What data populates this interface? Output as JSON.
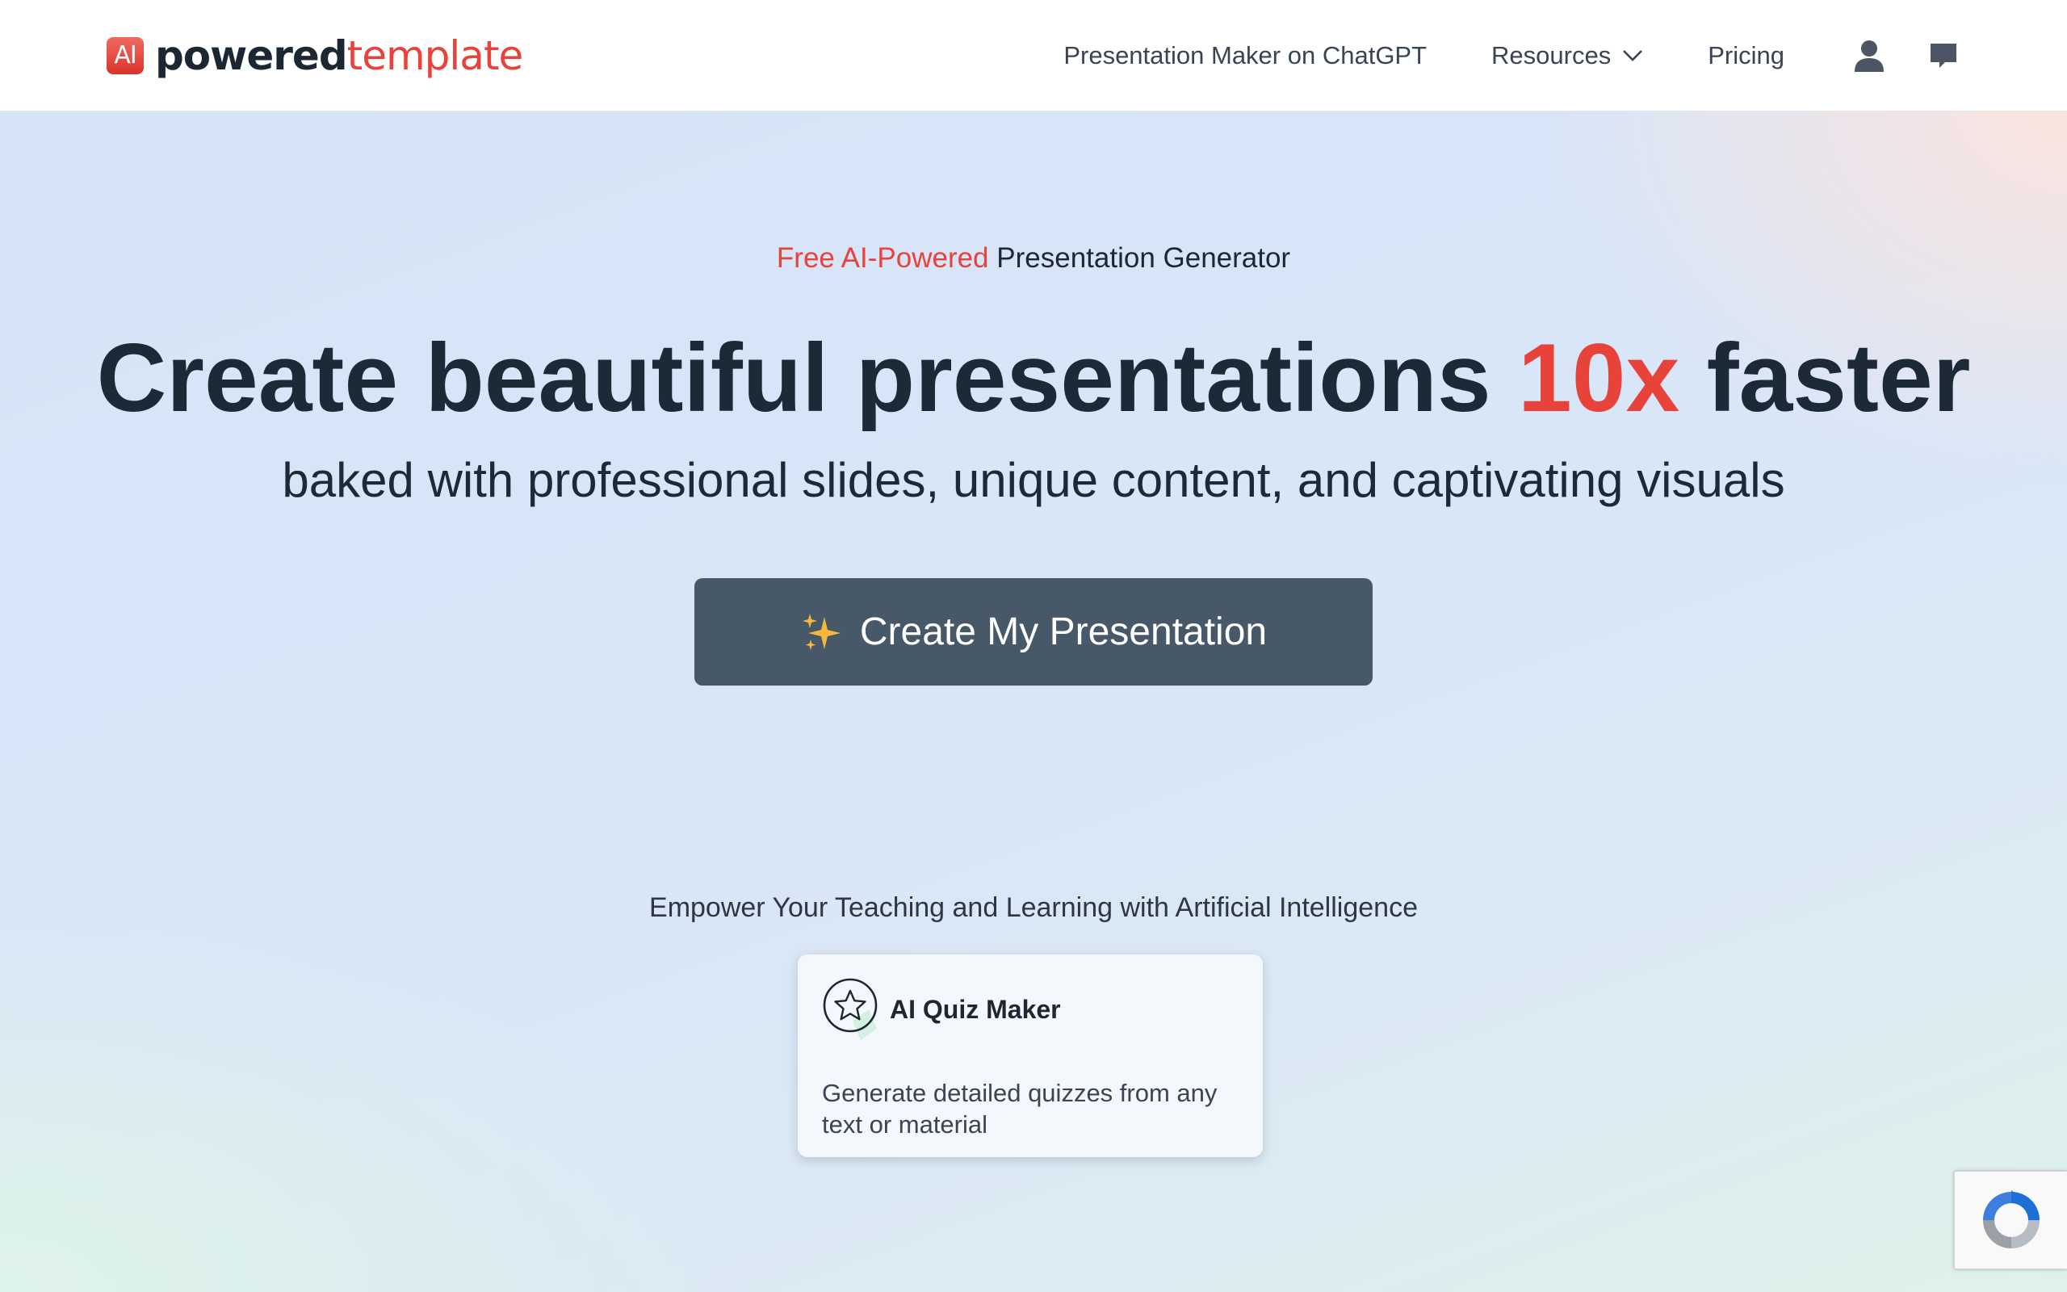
{
  "brand": {
    "badge": "AI",
    "name_bold": "powered",
    "name_light": "template"
  },
  "nav": {
    "chatgpt": "Presentation Maker on ChatGPT",
    "resources": "Resources",
    "pricing": "Pricing",
    "user_icon": "user-icon",
    "chat_icon": "chat-icon"
  },
  "hero": {
    "eyebrow_highlight": "Free AI-Powered",
    "eyebrow_rest": "Presentation Generator",
    "headline_before": "Create beautiful presentations",
    "headline_highlight": "10x",
    "headline_after": "faster",
    "subline": "baked with professional slides, unique content, and captivating visuals",
    "cta_label": "Create My Presentation"
  },
  "section": {
    "title": "Empower Your Teaching and Learning with Artificial Intelligence",
    "cards": [
      {
        "icon": "star-icon",
        "title": "AI Quiz Maker",
        "description": "Generate detailed quizzes from any text or material"
      }
    ]
  },
  "colors": {
    "accent": "#e8433a",
    "cta_bg": "#475869",
    "text_dark": "#1b2a36"
  }
}
